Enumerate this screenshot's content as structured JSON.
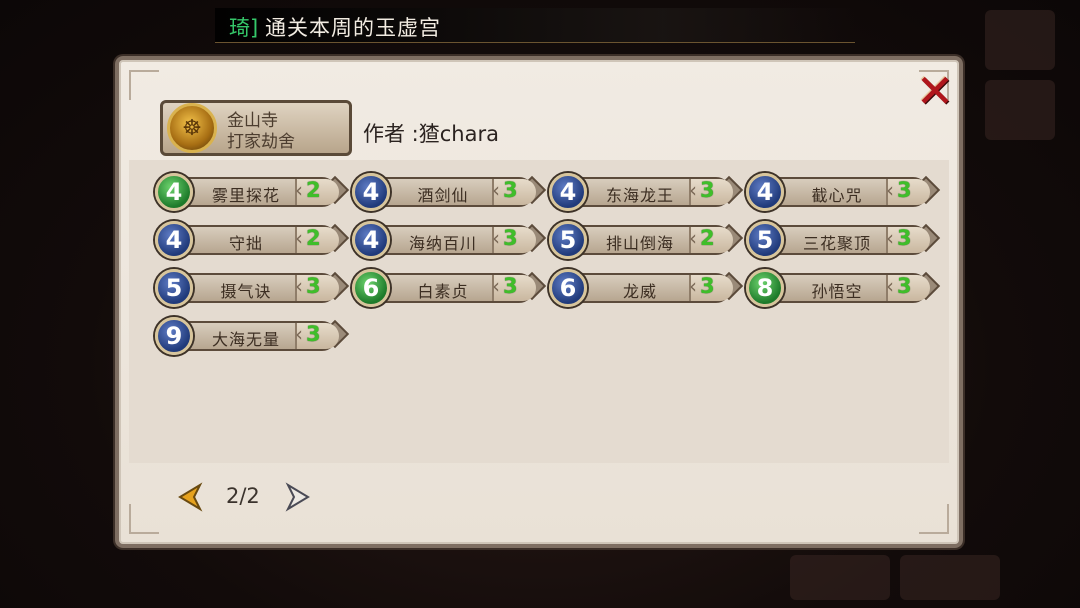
{
  "banner": {
    "name": "琦]",
    "text": "通关本周的玉虚宫"
  },
  "panel": {
    "close_icon": "close-x-icon",
    "author": {
      "avatar_icon": "monk-avatar-icon",
      "line1": "金山寺",
      "line2": "打家劫舍",
      "label": "作者 :猹chara"
    },
    "skills": [
      {
        "level": "4",
        "level_color": "green",
        "name": "雾里探花",
        "count": "2"
      },
      {
        "level": "4",
        "level_color": "blue",
        "name": "酒剑仙",
        "count": "3"
      },
      {
        "level": "4",
        "level_color": "blue",
        "name": "东海龙王",
        "count": "3"
      },
      {
        "level": "4",
        "level_color": "blue",
        "name": "截心咒",
        "count": "3"
      },
      {
        "level": "4",
        "level_color": "blue",
        "name": "守拙",
        "count": "2"
      },
      {
        "level": "4",
        "level_color": "blue",
        "name": "海纳百川",
        "count": "3"
      },
      {
        "level": "5",
        "level_color": "blue",
        "name": "排山倒海",
        "count": "2"
      },
      {
        "level": "5",
        "level_color": "blue",
        "name": "三花聚顶",
        "count": "3"
      },
      {
        "level": "5",
        "level_color": "blue",
        "name": "摄气诀",
        "count": "3"
      },
      {
        "level": "6",
        "level_color": "green",
        "name": "白素贞",
        "count": "3"
      },
      {
        "level": "6",
        "level_color": "blue",
        "name": "龙威",
        "count": "3"
      },
      {
        "level": "8",
        "level_color": "green",
        "name": "孙悟空",
        "count": "3"
      },
      {
        "level": "9",
        "level_color": "blue",
        "name": "大海无量",
        "count": "3"
      }
    ],
    "pager": {
      "text": "2/2",
      "prev_icon": "arrow-left-icon",
      "next_icon": "arrow-right-icon"
    }
  }
}
